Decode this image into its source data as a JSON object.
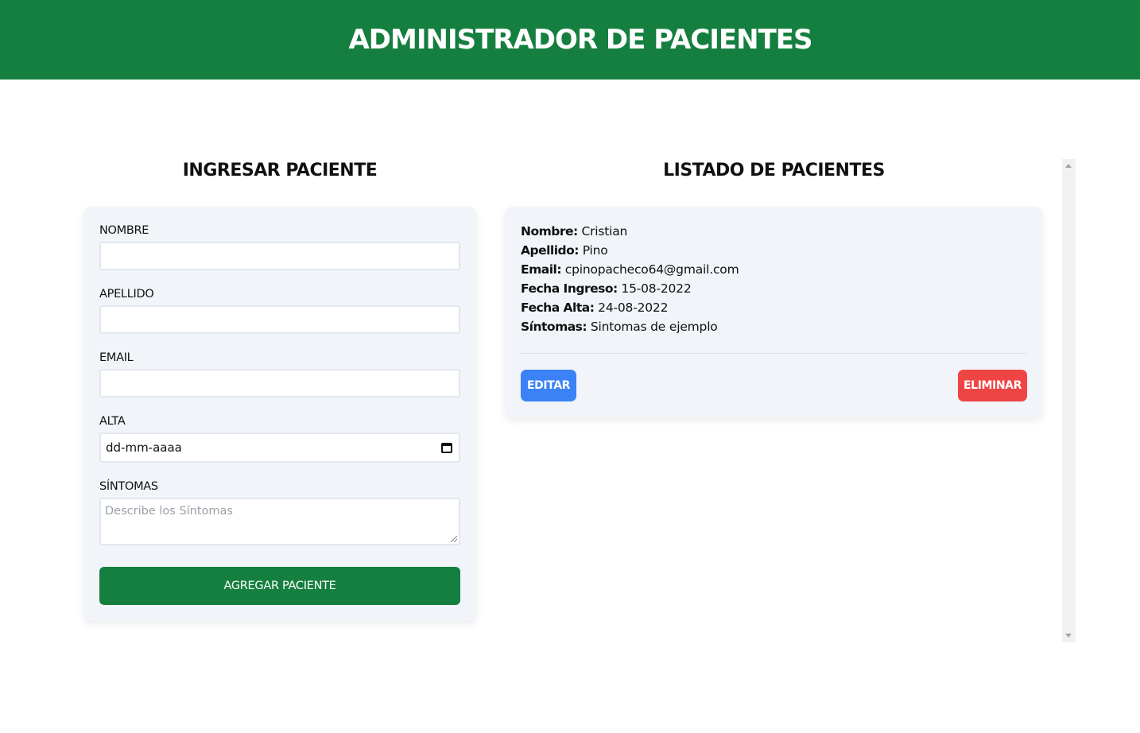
{
  "header": {
    "title": "ADMINISTRADOR DE PACIENTES"
  },
  "form": {
    "title": "INGRESAR PACIENTE",
    "fields": {
      "nombre": {
        "label": "NOMBRE",
        "value": ""
      },
      "apellido": {
        "label": "APELLIDO",
        "value": ""
      },
      "email": {
        "label": "EMAIL",
        "value": ""
      },
      "alta": {
        "label": "ALTA",
        "value": "dd-mm-aaaa"
      },
      "sintomas": {
        "label": "SÍNTOMAS",
        "placeholder": "Describe los Síntomas"
      }
    },
    "submit_label": "AGREGAR PACIENTE"
  },
  "list": {
    "title": "LISTADO DE PACIENTES",
    "patients": [
      {
        "nombre_label": "Nombre:",
        "nombre": "Cristian",
        "apellido_label": "Apellido:",
        "apellido": "Pino",
        "email_label": "Email:",
        "email": "cpinopacheco64@gmail.com",
        "ingreso_label": "Fecha Ingreso:",
        "ingreso": "15-08-2022",
        "alta_label": "Fecha Alta:",
        "alta": "24-08-2022",
        "sintomas_label": "Síntomas:",
        "sintomas": "Sintomas de ejemplo",
        "edit_label": "EDITAR",
        "delete_label": "ELIMINAR"
      }
    ]
  },
  "colors": {
    "brand_green": "#157f3f",
    "card_bg": "#f1f4f9",
    "edit_blue": "#3b82f6",
    "delete_red": "#ef4444"
  },
  "icons": {
    "date_picker": "calendar-icon"
  }
}
